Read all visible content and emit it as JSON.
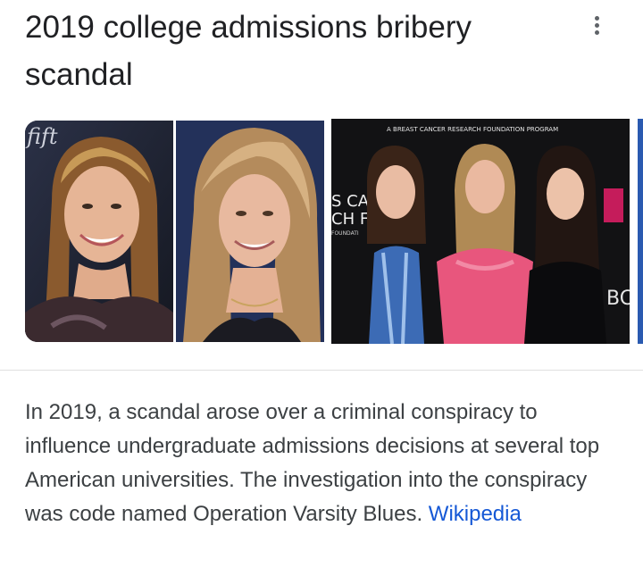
{
  "title": "2019 college admissions bribery scandal",
  "images": {
    "img1_caption_partial": "fift",
    "img3_banner": "A BREAST CANCER RESEARCH FOUNDATION PROGRAM",
    "img3_sign_line1": "S CAN",
    "img3_sign_line2": "CH FU",
    "img3_sign_line3": "FOUNDATI",
    "img3_right_letters": "BC"
  },
  "description": {
    "text": "In 2019, a scandal arose over a criminal conspiracy to influence undergraduate admissions decisions at several top American universities. The investigation into the conspiracy was code named Operation Varsity Blues.",
    "source_link": "Wikipedia"
  }
}
